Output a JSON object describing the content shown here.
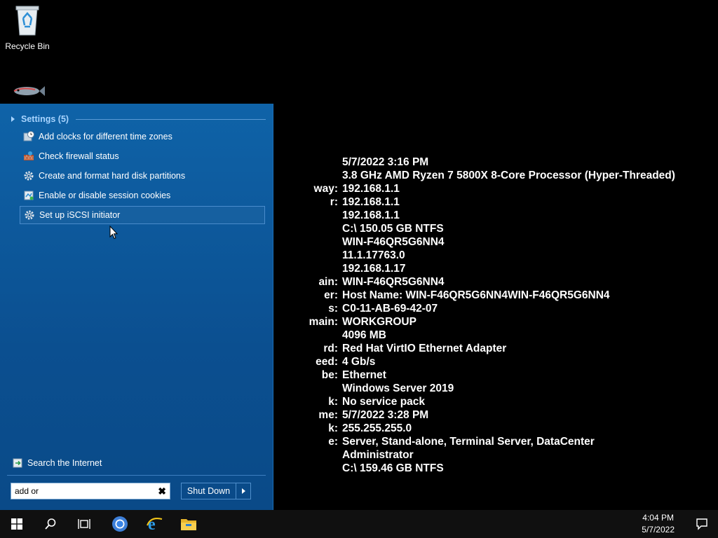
{
  "desktop": {
    "recycle_bin_label": "Recycle Bin"
  },
  "info": {
    "labels": [
      "",
      "",
      "way:",
      "r:",
      "",
      "",
      "",
      "",
      "",
      "ain:",
      "er:",
      "s:",
      "main:",
      "",
      "rd:",
      "eed:",
      "be:",
      "",
      "k:",
      "me:",
      "k:",
      "e:",
      "",
      ""
    ],
    "values": [
      "5/7/2022 3:16 PM",
      "3.8 GHz AMD Ryzen 7 5800X 8-Core Processor (Hyper-Threaded)",
      "192.168.1.1",
      "192.168.1.1",
      "192.168.1.1",
      "C:\\ 150.05 GB NTFS",
      "WIN-F46QR5G6NN4",
      "11.1.17763.0",
      "192.168.1.17",
      "WIN-F46QR5G6NN4",
      "Host Name:  WIN-F46QR5G6NN4WIN-F46QR5G6NN4",
      "C0-11-AB-69-42-07",
      "WORKGROUP",
      "4096 MB",
      "Red Hat VirtIO Ethernet Adapter",
      "4 Gb/s",
      "Ethernet",
      "Windows Server 2019",
      "No service pack",
      "5/7/2022 3:28 PM",
      "255.255.255.0",
      "Server, Stand-alone, Terminal Server, DataCenter",
      "Administrator",
      "C:\\ 159.46 GB NTFS"
    ]
  },
  "start_menu": {
    "section_title": "Settings (5)",
    "results": [
      {
        "label": "Add clocks for different time zones",
        "icon": "clock-icon"
      },
      {
        "label": "Check firewall status",
        "icon": "firewall-icon"
      },
      {
        "label": "Create and format hard disk partitions",
        "icon": "gear-icon"
      },
      {
        "label": "Enable or disable session cookies",
        "icon": "cookie-icon"
      },
      {
        "label": "Set up iSCSI initiator",
        "icon": "gear-icon"
      }
    ],
    "search_internet_label": "Search the Internet",
    "search_value": "add or",
    "shutdown_label": "Shut Down"
  },
  "taskbar": {
    "time": "4:04 PM",
    "date": "5/7/2022"
  },
  "colors": {
    "menu_bg": "#0b4f90",
    "section_head": "#a8d4ff",
    "taskbar": "#101010"
  }
}
